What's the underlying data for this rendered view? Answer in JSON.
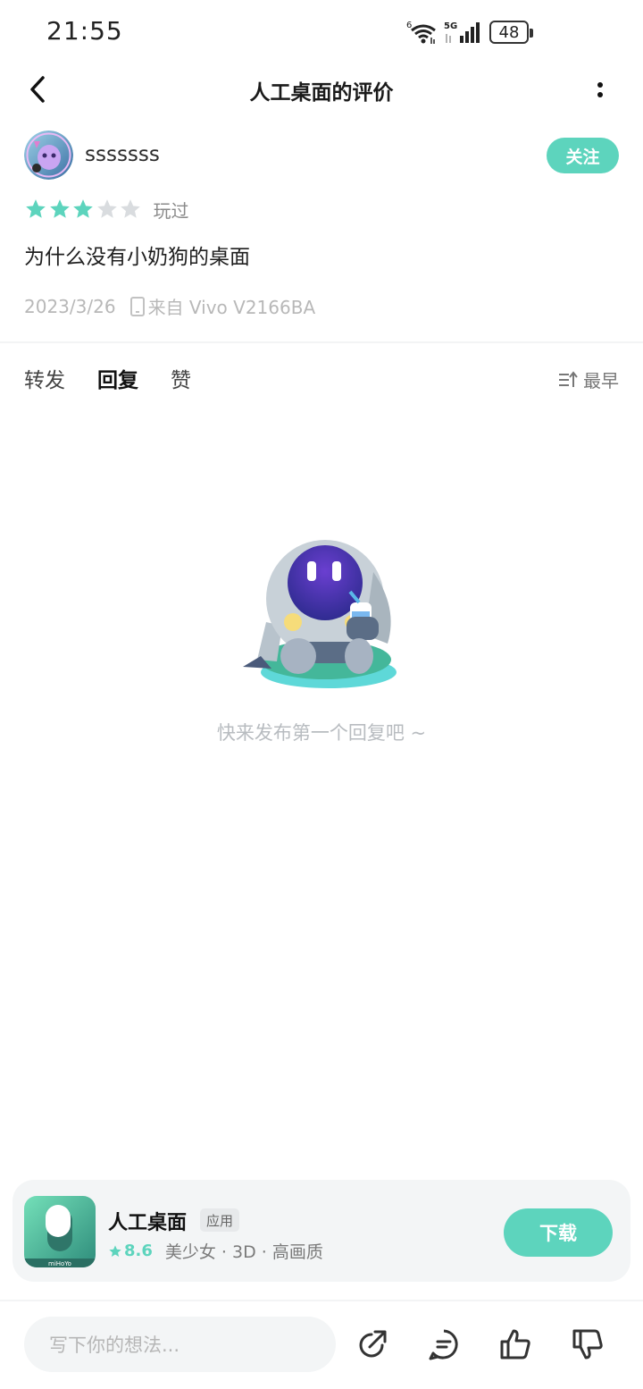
{
  "status_bar": {
    "time": "21:55",
    "battery": "48",
    "network": "5G"
  },
  "header": {
    "title": "人工桌面的评价"
  },
  "review": {
    "username": "sssssss",
    "follow_label": "关注",
    "rating": 3,
    "max_rating": 5,
    "played_label": "玩过",
    "text": "为什么没有小奶狗的桌面",
    "date": "2023/3/26",
    "device": "来自 Vivo V2166BA"
  },
  "tabs": [
    {
      "label": "转发",
      "active": false
    },
    {
      "label": "回复",
      "active": true
    },
    {
      "label": "赞",
      "active": false
    }
  ],
  "sort": {
    "label": "最早"
  },
  "empty_state": {
    "text": "快来发布第一个回复吧 ~"
  },
  "app_card": {
    "name": "人工桌面",
    "tag": "应用",
    "score": "8.6",
    "tags_text": "美少女 · 3D · 高画质",
    "download_label": "下载",
    "icon_brand": "miHoYo"
  },
  "comment_bar": {
    "placeholder": "写下你的想法..."
  },
  "colors": {
    "accent": "#5dd4bd",
    "star_empty": "#d9dcdf",
    "text_muted": "#b8b8b8"
  }
}
